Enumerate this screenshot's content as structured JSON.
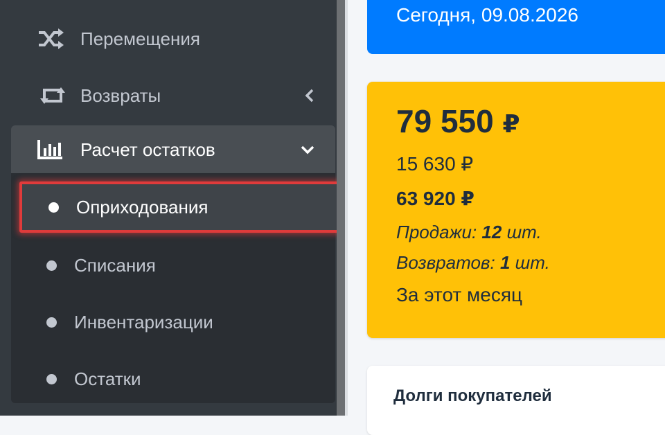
{
  "sidebar": {
    "items": [
      {
        "label": "Перемещения",
        "icon": "shuffle-icon"
      },
      {
        "label": "Возвраты",
        "icon": "exchange-icon",
        "chevron": "chevron-left-icon"
      },
      {
        "label": "Расчет остатков",
        "icon": "bar-chart-icon",
        "chevron": "chevron-down-icon",
        "expanded": true
      }
    ],
    "subitems": [
      {
        "label": "Оприходования",
        "active": true
      },
      {
        "label": "Списания"
      },
      {
        "label": "Инвентаризации"
      },
      {
        "label": "Остатки"
      }
    ]
  },
  "header_card": {
    "date_text": "Сегодня, 09.08.2026",
    "color": "#007bff"
  },
  "summary_card": {
    "color": "#ffc107",
    "total_amount": "79 550",
    "currency": "₽",
    "secondary_amount": "15 630 ₽",
    "bold_amount": "63 920 ₽",
    "sales_label": "Продажи:",
    "sales_count": "12",
    "sales_unit": "шт.",
    "returns_label": "Возвратов:",
    "returns_count": "1",
    "returns_unit": "шт.",
    "period": "За этот месяц"
  },
  "debts_card": {
    "title": "Долги покупателей"
  }
}
